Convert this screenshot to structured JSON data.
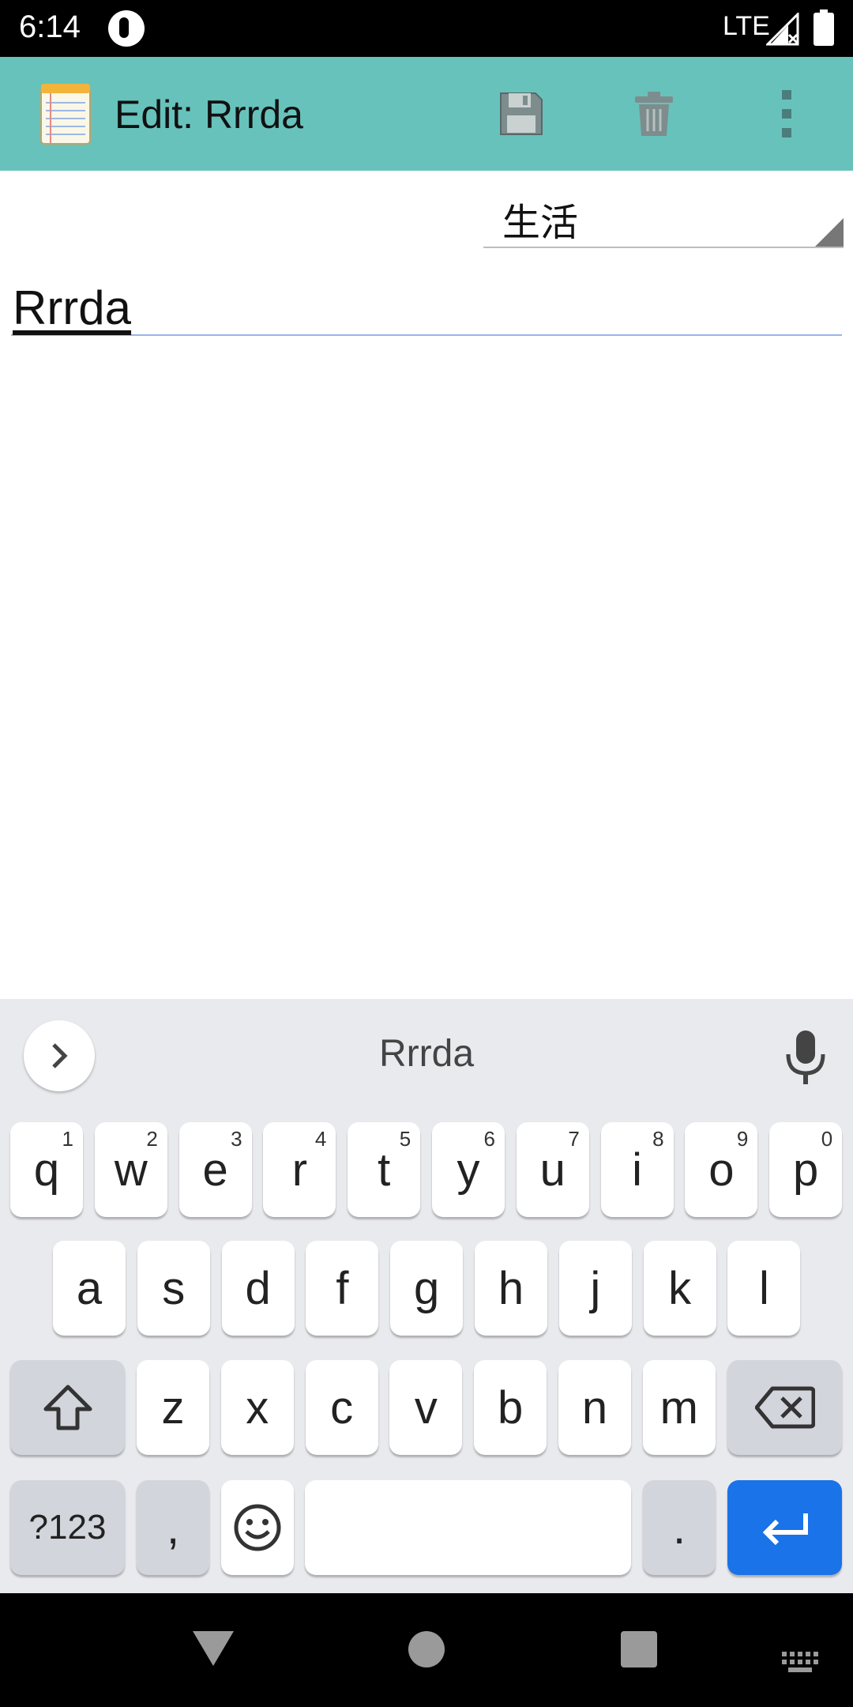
{
  "status_bar": {
    "time": "6:14",
    "network": "LTE"
  },
  "app_bar": {
    "title": "Edit: Rrrda",
    "icons": [
      "notepad-icon",
      "save-icon",
      "trash-icon",
      "more-vert-icon"
    ],
    "color": "#67c2bc"
  },
  "category": {
    "selected": "生活"
  },
  "note": {
    "title": "Rrrda"
  },
  "keyboard": {
    "suggestion": "Rrrda",
    "row1": [
      {
        "key": "q",
        "hint": "1"
      },
      {
        "key": "w",
        "hint": "2"
      },
      {
        "key": "e",
        "hint": "3"
      },
      {
        "key": "r",
        "hint": "4"
      },
      {
        "key": "t",
        "hint": "5"
      },
      {
        "key": "y",
        "hint": "6"
      },
      {
        "key": "u",
        "hint": "7"
      },
      {
        "key": "i",
        "hint": "8"
      },
      {
        "key": "o",
        "hint": "9"
      },
      {
        "key": "p",
        "hint": "0"
      }
    ],
    "row2": [
      "a",
      "s",
      "d",
      "f",
      "g",
      "h",
      "j",
      "k",
      "l"
    ],
    "row3": [
      "z",
      "x",
      "c",
      "v",
      "b",
      "n",
      "m"
    ],
    "symbols_label": "?123",
    "comma": ",",
    "period": ".",
    "accent_color": "#1a73e8"
  }
}
